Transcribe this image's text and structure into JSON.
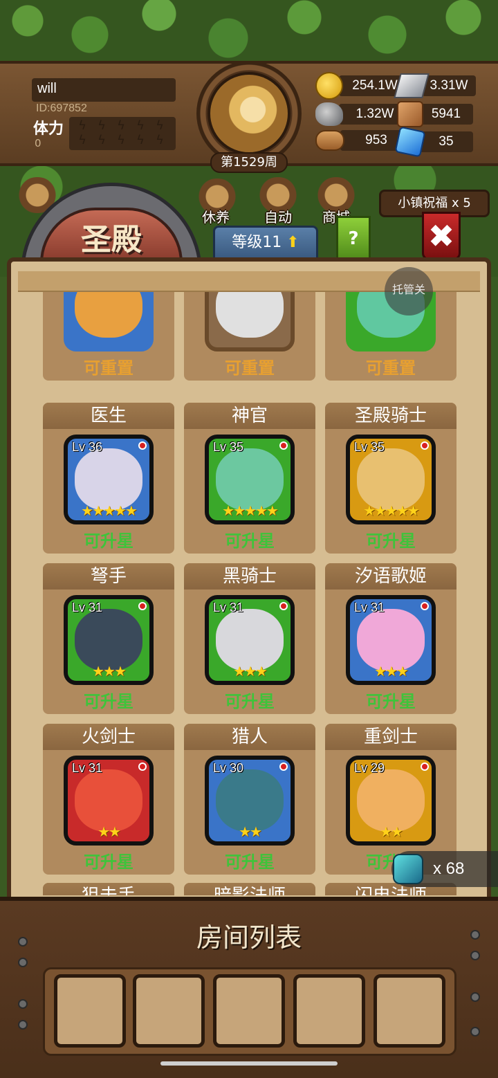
{
  "player": {
    "name": "will",
    "id": "ID:697852",
    "stamina_label": "体力",
    "stamina_value": "0"
  },
  "week": "第1529周",
  "resources": {
    "gold": "254.1W",
    "steel": "3.31W",
    "stone": "1.32W",
    "leather": "5941",
    "wood": "953",
    "crystal": "35"
  },
  "menu": {
    "items": [
      {
        "label": "休养",
        "icon": "rest-icon"
      },
      {
        "label": "自动",
        "icon": "auto-icon"
      },
      {
        "label": "商城",
        "icon": "shop-icon"
      }
    ],
    "blessing": "小镇祝福 x 5"
  },
  "building": {
    "title": "圣殿",
    "level": "等级11",
    "help": "?",
    "close": "✖",
    "auto_button": "托管关"
  },
  "heroes_top_row": [
    {
      "status": "可重置"
    },
    {
      "status": "可重置"
    },
    {
      "status": "可重置"
    }
  ],
  "heroes": [
    {
      "name": "医生",
      "level": "Lv 36",
      "stars": "★★★★★",
      "status": "可升星",
      "frame": "#3a74c8",
      "skin": "#d8d4e8"
    },
    {
      "name": "神官",
      "level": "Lv 35",
      "stars": "★★★★★",
      "status": "可升星",
      "frame": "#3aa82a",
      "skin": "#6cc8a0"
    },
    {
      "name": "圣殿骑士",
      "level": "Lv 35",
      "stars": "★★★★★",
      "status": "可升星",
      "frame": "#d89a12",
      "skin": "#e8c070"
    },
    {
      "name": "弩手",
      "level": "Lv 31",
      "stars": "★★★",
      "status": "可升星",
      "frame": "#3aa82a",
      "skin": "#3a4a5a"
    },
    {
      "name": "黑骑士",
      "level": "Lv 31",
      "stars": "★★★",
      "status": "可升星",
      "frame": "#3aa82a",
      "skin": "#d8d8dc"
    },
    {
      "name": "汐语歌姬",
      "level": "Lv 31",
      "stars": "★★★",
      "status": "可升星",
      "frame": "#3a74c8",
      "skin": "#f0a8d8"
    },
    {
      "name": "火剑士",
      "level": "Lv 31",
      "stars": "★★",
      "status": "可升星",
      "frame": "#c82a2a",
      "skin": "#e8503a"
    },
    {
      "name": "猎人",
      "level": "Lv 30",
      "stars": "★★",
      "status": "可升星",
      "frame": "#3a74c8",
      "skin": "#3a7a8a"
    },
    {
      "name": "重剑士",
      "level": "Lv 29",
      "stars": "★★",
      "status": "可升星",
      "frame": "#d89a12",
      "skin": "#f0b060"
    }
  ],
  "heroes_partial_row": [
    "狙击手",
    "暗影法师",
    "闪电法师"
  ],
  "fragments": {
    "count": "x 68"
  },
  "room_list": {
    "title": "房间列表"
  }
}
